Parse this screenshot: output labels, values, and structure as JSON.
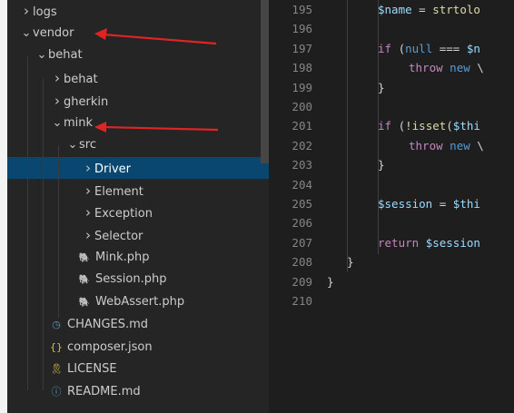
{
  "explorer": {
    "items": [
      {
        "label": "logs",
        "kind": "folder",
        "expanded": false,
        "depth": 0
      },
      {
        "label": "vendor",
        "kind": "folder",
        "expanded": true,
        "depth": 0
      },
      {
        "label": "behat",
        "kind": "folder",
        "expanded": true,
        "depth": 1
      },
      {
        "label": "behat",
        "kind": "folder",
        "expanded": false,
        "depth": 2
      },
      {
        "label": "gherkin",
        "kind": "folder",
        "expanded": false,
        "depth": 2
      },
      {
        "label": "mink",
        "kind": "folder",
        "expanded": true,
        "depth": 2
      },
      {
        "label": "src",
        "kind": "folder",
        "expanded": true,
        "depth": 3
      },
      {
        "label": "Driver",
        "kind": "folder",
        "expanded": false,
        "depth": 4,
        "selected": true
      },
      {
        "label": "Element",
        "kind": "folder",
        "expanded": false,
        "depth": 4
      },
      {
        "label": "Exception",
        "kind": "folder",
        "expanded": false,
        "depth": 4
      },
      {
        "label": "Selector",
        "kind": "folder",
        "expanded": false,
        "depth": 4
      },
      {
        "label": "Mink.php",
        "kind": "php",
        "depth": 4
      },
      {
        "label": "Session.php",
        "kind": "php",
        "depth": 4
      },
      {
        "label": "WebAssert.php",
        "kind": "php",
        "depth": 4
      },
      {
        "label": "CHANGES.md",
        "kind": "changes",
        "depth": 3
      },
      {
        "label": "composer.json",
        "kind": "json",
        "depth": 3
      },
      {
        "label": "LICENSE",
        "kind": "license",
        "depth": 3
      },
      {
        "label": "README.md",
        "kind": "readme",
        "depth": 3
      }
    ]
  },
  "icons": {
    "folder_collapsed": "chevron-right-icon",
    "folder_expanded": "chevron-down-icon",
    "php": "php-elephant-icon",
    "changes": "clock-icon",
    "json": "braces-icon",
    "license": "license-icon",
    "readme": "info-icon"
  },
  "colors": {
    "selection": "#094771",
    "annotation_arrow": "#e02424",
    "php_icon": "#a074c4",
    "json_icon": "#cbcb41",
    "license_icon": "#e8c547",
    "info_icon": "#519aba"
  },
  "editor": {
    "lines": [
      {
        "no": "195",
        "indent": 2,
        "tokens": [
          [
            "var",
            "$name"
          ],
          [
            "pun",
            " = "
          ],
          [
            "fn",
            "strtolo"
          ]
        ]
      },
      {
        "no": "196",
        "indent": 0,
        "tokens": []
      },
      {
        "no": "197",
        "indent": 2,
        "tokens": [
          [
            "ctrl",
            "if"
          ],
          [
            "pun",
            " ("
          ],
          [
            "kw",
            "null"
          ],
          [
            "pun",
            " === "
          ],
          [
            "var",
            "$n"
          ]
        ]
      },
      {
        "no": "198",
        "indent": 3,
        "tokens": [
          [
            "ctrl",
            "throw"
          ],
          [
            "pun",
            " "
          ],
          [
            "kw",
            "new"
          ],
          [
            "pun",
            " \\"
          ]
        ]
      },
      {
        "no": "199",
        "indent": 2,
        "tokens": [
          [
            "pun",
            "}"
          ]
        ]
      },
      {
        "no": "200",
        "indent": 0,
        "tokens": []
      },
      {
        "no": "201",
        "indent": 2,
        "tokens": [
          [
            "ctrl",
            "if"
          ],
          [
            "pun",
            " (!"
          ],
          [
            "fn",
            "isset"
          ],
          [
            "pun",
            "("
          ],
          [
            "var",
            "$thi"
          ]
        ]
      },
      {
        "no": "202",
        "indent": 3,
        "tokens": [
          [
            "ctrl",
            "throw"
          ],
          [
            "pun",
            " "
          ],
          [
            "kw",
            "new"
          ],
          [
            "pun",
            " \\"
          ]
        ]
      },
      {
        "no": "203",
        "indent": 2,
        "tokens": [
          [
            "pun",
            "}"
          ]
        ]
      },
      {
        "no": "204",
        "indent": 0,
        "tokens": []
      },
      {
        "no": "205",
        "indent": 2,
        "tokens": [
          [
            "var",
            "$session"
          ],
          [
            "pun",
            " = "
          ],
          [
            "var",
            "$thi"
          ]
        ]
      },
      {
        "no": "206",
        "indent": 0,
        "tokens": []
      },
      {
        "no": "207",
        "indent": 2,
        "tokens": [
          [
            "ctrl",
            "return"
          ],
          [
            "pun",
            " "
          ],
          [
            "var",
            "$session"
          ]
        ]
      },
      {
        "no": "208",
        "indent": 1,
        "tokens": [
          [
            "pun",
            "}"
          ]
        ]
      },
      {
        "no": "209",
        "indent": 0,
        "tokens": [
          [
            "pun",
            "}"
          ]
        ]
      },
      {
        "no": "210",
        "indent": 0,
        "tokens": []
      }
    ]
  }
}
